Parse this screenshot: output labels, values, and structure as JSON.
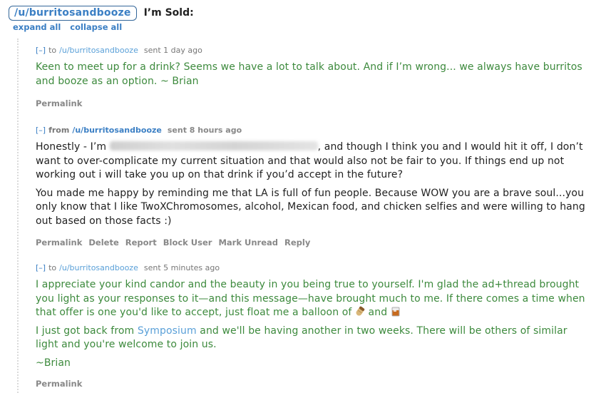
{
  "header": {
    "username": "/u/burritosandbooze",
    "subject": "I’m Sold:"
  },
  "controls": {
    "expand_all": "expand all",
    "collapse_all": "collapse all"
  },
  "messages": [
    {
      "toggle": "[–]",
      "direction": "to",
      "user": "/u/burritosandbooze",
      "time": "sent 1 day ago",
      "paragraphs": [
        "Keen to meet up for a drink? Seems we have a lot to talk about. And if I’m wrong... we always have burritos and booze as an option. ~ Brian"
      ],
      "buttons": [
        "Permalink"
      ]
    },
    {
      "toggle": "[–]",
      "direction": "from",
      "user": "/u/burritosandbooze",
      "time": "sent 8 hours ago",
      "p1_start": "Honestly - I’m",
      "p1_end": ", and though I think you and I would hit it off, I don’t want to over-complicate my current situation and that would also not be fair to you. If things end up not working out i will take you up on that drink if you’d accept in the future?",
      "p2": "You made me happy by reminding me that LA is full of fun people. Because WOW you are a brave soul...you only know that I like TwoXChromosomes, alcohol, Mexican food, and chicken selfies and were willing to hang out based on those facts :)",
      "buttons": [
        "Permalink",
        "Delete",
        "Report",
        "Block User",
        "Mark Unread",
        "Reply"
      ]
    },
    {
      "toggle": "[–]",
      "direction": "to",
      "user": "/u/burritosandbooze",
      "time": "sent 5 minutes ago",
      "p1": "I appreciate your kind candor and the beauty in you being true to yourself. I'm glad the ad+thread brought you light as your responses to it—and this message—have brought much to me. If there comes a time when that offer is one you'd like to accept, just float me a balloon of",
      "p1_and": "and",
      "p2_start": "I just got back from",
      "p2_link": "Symposium",
      "p2_end": "and we'll be having another in two weeks. There will be others of similar light and you're welcome to join us.",
      "p3": "~Brian",
      "emoji_1": "burrito-icon",
      "emoji_2": "whiskey-glass-icon",
      "buttons": [
        "Permalink"
      ]
    }
  ]
}
